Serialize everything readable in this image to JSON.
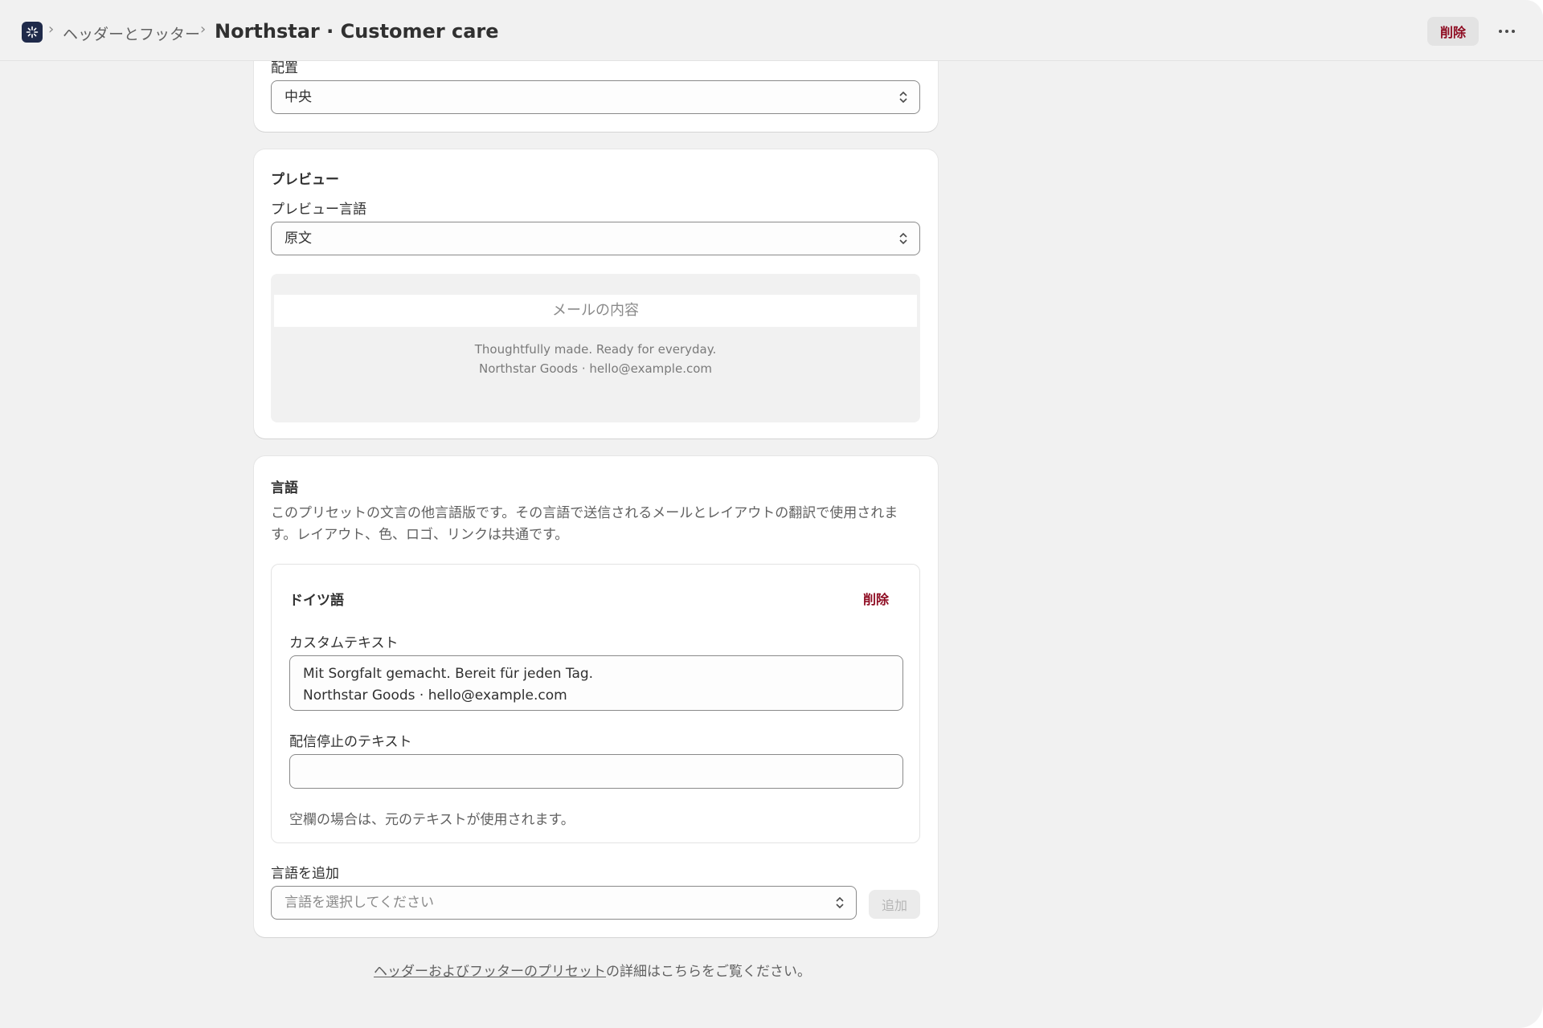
{
  "header": {
    "breadcrumb_parent": "ヘッダーとフッター",
    "title": "Northstar · Customer care",
    "delete_label": "削除",
    "more_icon": "ellipsis-horizontal-icon",
    "app_icon": "sparkle-app-icon"
  },
  "placement_card": {
    "label": "配置",
    "selected_value": "中央"
  },
  "preview_card": {
    "title": "プレビュー",
    "language_label": "プレビュー言語",
    "language_value": "原文",
    "mail_content_placeholder": "メールの内容",
    "footer_line1": "Thoughtfully made. Ready for everyday.",
    "footer_line2": "Northstar Goods · hello@example.com"
  },
  "language_card": {
    "title": "言語",
    "description": "このプリセットの文言の他言語版です。その言語で送信されるメールとレイアウトの翻訳で使用されます。レイアウト、色、ロゴ、リンクは共通です。",
    "german": {
      "name": "ドイツ語",
      "delete_label": "削除",
      "custom_text_label": "カスタムテキスト",
      "custom_text_line1": "Mit Sorgfalt gemacht. Bereit für jeden Tag.",
      "custom_text_line2": "Northstar Goods · hello@example.com",
      "unsubscribe_label": "配信停止のテキスト",
      "unsubscribe_value": "",
      "hint": "空欄の場合は、元のテキストが使用されます。"
    },
    "add_language_label": "言語を追加",
    "add_language_placeholder": "言語を選択してください",
    "add_button_label": "追加"
  },
  "bottom_note": {
    "link_text": "ヘッダーおよびフッターのプリセット",
    "rest_text": "の詳細はこちらをご覧ください。"
  },
  "colors": {
    "critical": "#8e0b21",
    "background": "#f1f1f1",
    "card": "#ffffff"
  }
}
